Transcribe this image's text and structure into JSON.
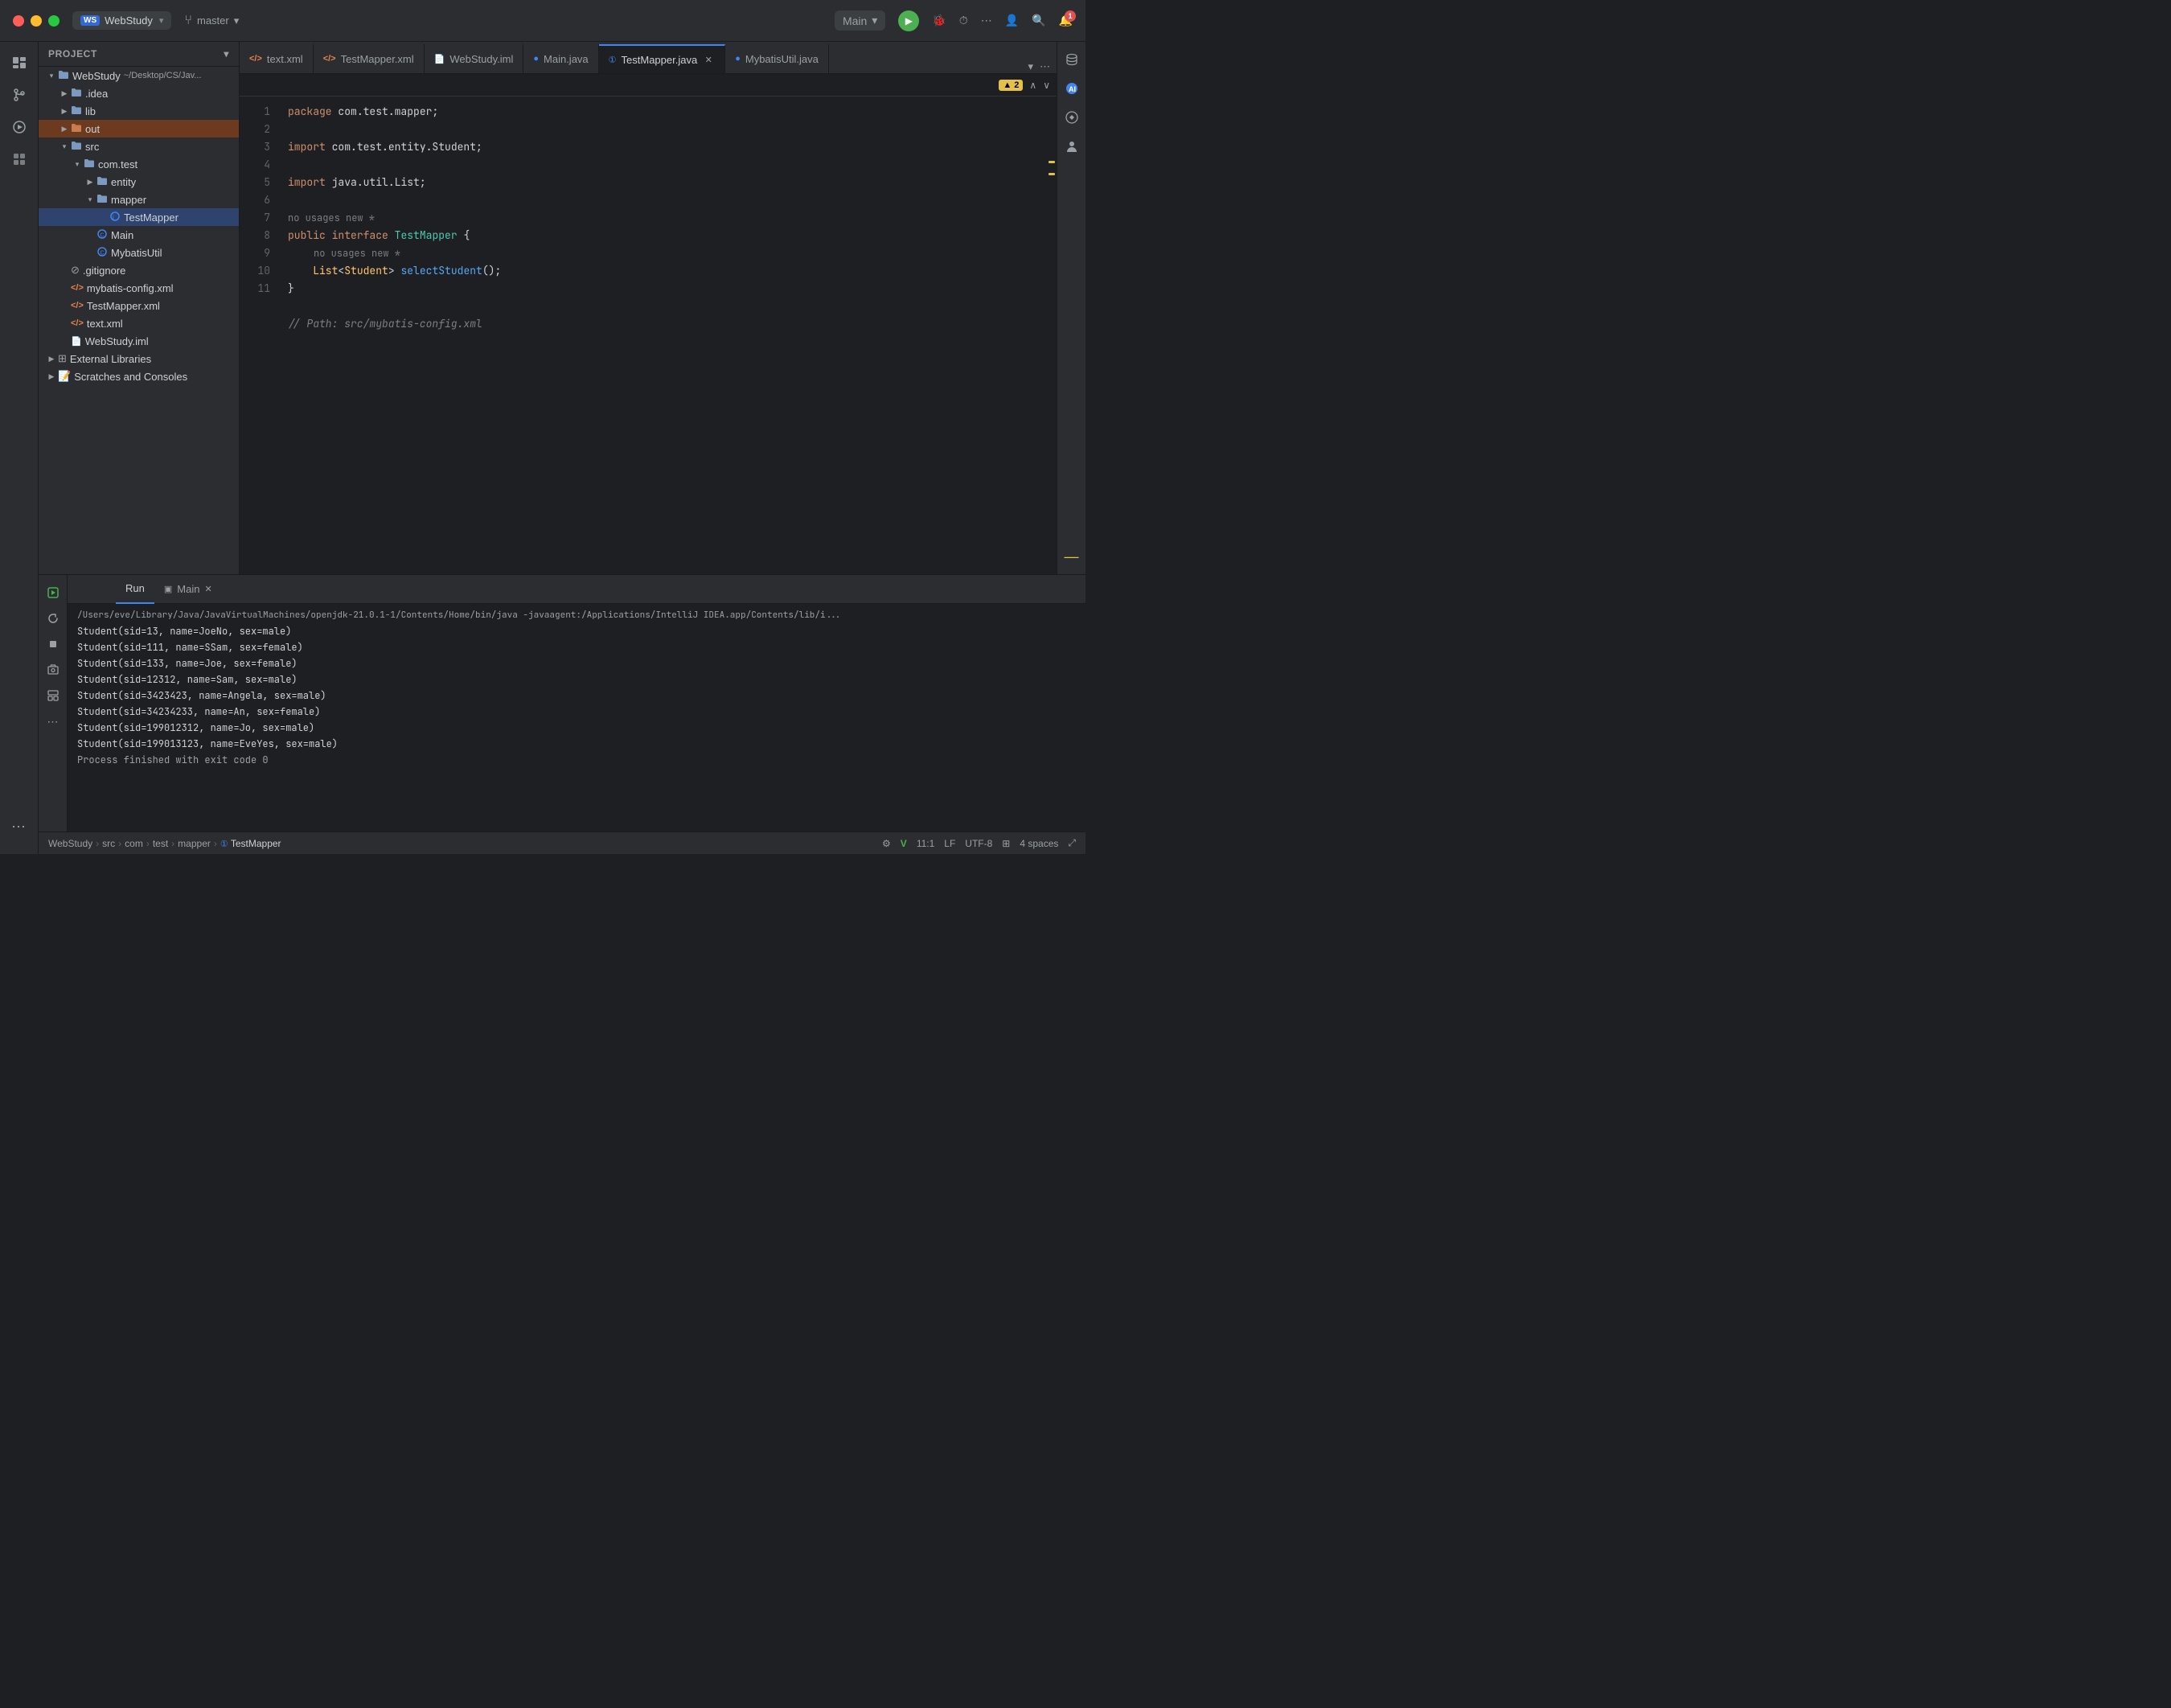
{
  "titleBar": {
    "projectName": "WebStudy",
    "projectChevron": "▾",
    "branchIcon": "⑂",
    "branchName": "master",
    "branchChevron": "▾",
    "mainLabel": "Main",
    "mainChevron": "▾",
    "runBtn": "▶",
    "debugBtn": "🐛",
    "profileBtn": "⏱",
    "moreBtn": "⋯",
    "accountIcon": "👤",
    "searchIcon": "🔍",
    "settingsIcon": "⚙"
  },
  "sidebar": {
    "headerLabel": "Project",
    "headerChevron": "▾",
    "items": [
      {
        "label": "WebStudy",
        "path": "~/Desktop/CS/Java",
        "type": "root",
        "indent": 0,
        "expanded": true
      },
      {
        "label": ".idea",
        "type": "folder",
        "indent": 1,
        "expanded": false
      },
      {
        "label": "lib",
        "type": "folder",
        "indent": 1,
        "expanded": false
      },
      {
        "label": "out",
        "type": "folder-orange",
        "indent": 1,
        "expanded": false,
        "highlighted": true
      },
      {
        "label": "src",
        "type": "folder",
        "indent": 1,
        "expanded": true
      },
      {
        "label": "com.test",
        "type": "folder",
        "indent": 2,
        "expanded": true
      },
      {
        "label": "entity",
        "type": "folder",
        "indent": 3,
        "expanded": false
      },
      {
        "label": "mapper",
        "type": "folder",
        "indent": 3,
        "expanded": true
      },
      {
        "label": "TestMapper",
        "type": "interface",
        "indent": 4,
        "selected": true
      },
      {
        "label": "Main",
        "type": "java",
        "indent": 3
      },
      {
        "label": "MybatisUtil",
        "type": "java",
        "indent": 3
      },
      {
        "label": ".gitignore",
        "type": "gitignore",
        "indent": 1
      },
      {
        "label": "mybatis-config.xml",
        "type": "xml",
        "indent": 1
      },
      {
        "label": "TestMapper.xml",
        "type": "xml",
        "indent": 1
      },
      {
        "label": "text.xml",
        "type": "xml",
        "indent": 1
      },
      {
        "label": "WebStudy.iml",
        "type": "iml",
        "indent": 1
      },
      {
        "label": "External Libraries",
        "type": "folder",
        "indent": 0,
        "expanded": false
      },
      {
        "label": "Scratches and Consoles",
        "type": "scratches",
        "indent": 0,
        "expanded": false
      }
    ]
  },
  "tabs": [
    {
      "label": "text.xml",
      "type": "xml",
      "active": false
    },
    {
      "label": "TestMapper.xml",
      "type": "xml",
      "active": false
    },
    {
      "label": "WebStudy.iml",
      "type": "iml",
      "active": false
    },
    {
      "label": "Main.java",
      "type": "java",
      "active": false
    },
    {
      "label": "TestMapper.java",
      "type": "interface",
      "active": true,
      "closable": true
    },
    {
      "label": "MybatisUtil.java",
      "type": "java",
      "active": false
    }
  ],
  "editor": {
    "warningCount": "▲2",
    "lines": [
      {
        "num": 1,
        "code": "package com.test.mapper;"
      },
      {
        "num": 2,
        "code": ""
      },
      {
        "num": 3,
        "code": "import com.test.entity.Student;"
      },
      {
        "num": 4,
        "code": ""
      },
      {
        "num": 5,
        "code": "import java.util.List;"
      },
      {
        "num": 6,
        "code": ""
      },
      {
        "num": 7,
        "code": "public interface TestMapper {",
        "hint": "no usages   new *"
      },
      {
        "num": 8,
        "code": "    List<Student> selectStudent();",
        "hint2": "no usages   new *"
      },
      {
        "num": 9,
        "code": "}"
      },
      {
        "num": 10,
        "code": ""
      },
      {
        "num": 11,
        "code": "// Path: src/mybatis-config.xml"
      }
    ]
  },
  "bottomPanel": {
    "tabs": [
      {
        "label": "Run",
        "active": true
      },
      {
        "label": "Main",
        "active": false,
        "closable": true
      }
    ],
    "consoleLines": [
      "/Users/eve/Library/Java/JavaVirtualMachines/openjdk-21.0.1-1/Contents/Home/bin/java -javaagent:/Applications/IntelliJ IDEA.app/Contents/lib/i",
      "Student(sid=13, name=JoeNo, sex=male)",
      "Student(sid=111, name=SSam, sex=female)",
      "Student(sid=133, name=Joe, sex=female)",
      "Student(sid=12312, name=Sam, sex=male)",
      "Student(sid=3423423, name=Angela, sex=male)",
      "Student(sid=34234233, name=An, sex=female)",
      "Student(sid=199012312, name=Jo, sex=male)",
      "Student(sid=199013123, name=EveYes, sex=male)",
      "",
      "Process finished with exit code 0"
    ]
  },
  "statusBar": {
    "breadcrumbs": [
      "WebStudy",
      "src",
      "com",
      "test",
      "mapper",
      "TestMapper"
    ],
    "position": "11:1",
    "lineEnding": "LF",
    "encoding": "UTF-8",
    "indent": "4 spaces",
    "gearIcon": "⚙",
    "vIcon": "V",
    "indentIcon": "↔",
    "lockIcon": "🔒"
  },
  "activityBar": {
    "icons": [
      {
        "name": "folder-icon",
        "symbol": "📁"
      },
      {
        "name": "git-icon",
        "symbol": "⊕"
      },
      {
        "name": "users-icon",
        "symbol": "👥"
      },
      {
        "name": "plugins-icon",
        "symbol": "⊞"
      },
      {
        "name": "more-icon",
        "symbol": "⋯"
      }
    ]
  },
  "rightPanel": {
    "icons": [
      {
        "name": "database-icon",
        "symbol": "🗄"
      },
      {
        "name": "ai-icon",
        "symbol": "◉",
        "class": "ai-blue"
      },
      {
        "name": "copilot-icon",
        "symbol": "✦"
      },
      {
        "name": "user2-icon",
        "symbol": "👤"
      },
      {
        "name": "minus-icon",
        "symbol": "−"
      }
    ]
  }
}
